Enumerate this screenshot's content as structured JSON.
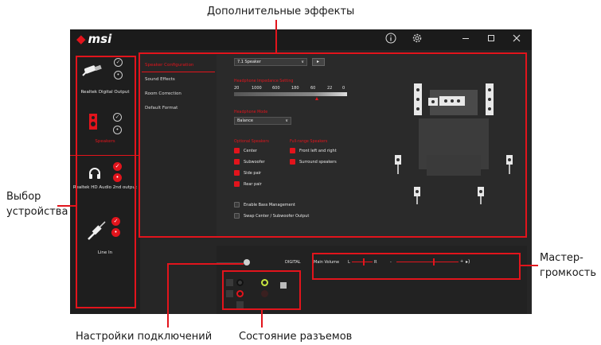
{
  "callouts": {
    "top": "Дополнительные эффекты",
    "left_line1": "Выбор",
    "left_line2": "устройства",
    "right_line1": "Мастер-",
    "right_line2": "громкость",
    "bottom_left": "Настройки подключений",
    "bottom_right": "Состояние разъемов"
  },
  "app": {
    "logo": "msi",
    "titlebar_icons": [
      "info-icon",
      "gear-icon",
      "minimize-icon",
      "maximize-icon",
      "close-icon"
    ]
  },
  "devices": [
    {
      "label": "Realtek Digital Output",
      "state": "ok",
      "icon": "optical-plug-icon"
    },
    {
      "label": "Speakers",
      "state": "active",
      "icon": "speaker-icon"
    },
    {
      "label": "Realtek HD Audio 2nd output",
      "state": "alert",
      "icon": "headphones-icon"
    },
    {
      "label": "Line In",
      "state": "alert",
      "icon": "jack-plug-icon"
    }
  ],
  "tabs": [
    "Speaker Configuration",
    "Sound Effects",
    "Room Correction",
    "Default Format"
  ],
  "speaker_config": {
    "config_value": "7.1 Speaker",
    "headphone_impedance_label": "Headphone Impedance Setting",
    "impedance_ticks": [
      "20",
      "1000",
      "600",
      "180",
      "60",
      "22",
      "0"
    ],
    "headphone_mode_label": "Headphone Mode",
    "headphone_mode_value": "Balance",
    "optional_label": "Optional Speakers",
    "optional_items": [
      "Center",
      "Subwoofer",
      "Side pair",
      "Rear pair"
    ],
    "fullrange_label": "Full-range Speakers",
    "fullrange_items": [
      "Front left and right",
      "Surround speakers"
    ],
    "enable_bass": "Enable Bass Management",
    "swap_center": "Swap Center / Subwoofer Output"
  },
  "bottom": {
    "digital_label": "DIGITAL",
    "main_volume_label": "Main Volume",
    "left_label": "L",
    "right_label": "R",
    "minus_label": "-",
    "plus_label": "+"
  },
  "colors": {
    "accent": "#e2141c",
    "app_bg": "#262626",
    "panel_bg": "#1e1e1e"
  }
}
